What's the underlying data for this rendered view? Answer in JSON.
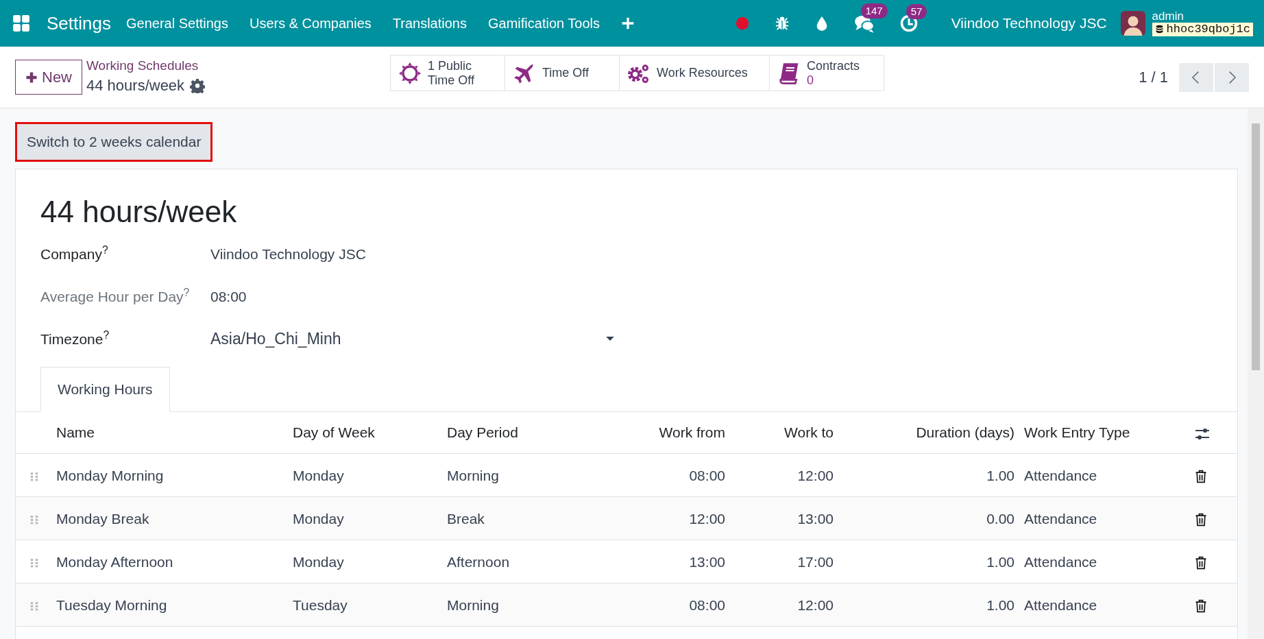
{
  "navbar": {
    "app_name": "Settings",
    "menu": [
      "General Settings",
      "Users & Companies",
      "Translations",
      "Gamification Tools"
    ],
    "systray": [
      {
        "kind": "record"
      },
      {
        "kind": "bug"
      },
      {
        "kind": "drop"
      },
      {
        "kind": "chat",
        "badge": "147"
      },
      {
        "kind": "activity",
        "badge": "57"
      }
    ],
    "company": "Viindoo Technology JSC",
    "user": "admin",
    "database": "hhoc39qboj1c"
  },
  "control_panel": {
    "new_button": "New",
    "breadcrumb": "Working Schedules",
    "record": "44 hours/week",
    "smart_buttons": [
      {
        "kind": "sun",
        "label": "1 Public Time Off"
      },
      {
        "kind": "plane",
        "label": "Time Off"
      },
      {
        "kind": "gears",
        "label": "Work Resources"
      },
      {
        "kind": "book",
        "label": "Contracts",
        "value": "0"
      }
    ],
    "pager": "1 / 1"
  },
  "form": {
    "switch_button": {
      "label": "Switch to 2 weeks calendar",
      "highlighted": true
    },
    "title": "44 hours/week",
    "fields": [
      {
        "label": "Company",
        "help": "?",
        "value": "Viindoo Technology JSC",
        "muted": false,
        "kind": "text"
      },
      {
        "label": "Average Hour per Day",
        "help": "?",
        "value": "08:00",
        "muted": true,
        "kind": "text"
      },
      {
        "label": "Timezone",
        "help": "?",
        "value": "Asia/Ho_Chi_Minh",
        "muted": false,
        "kind": "select"
      }
    ],
    "tabs": [
      {
        "label": "Working Hours",
        "selected": true
      }
    ],
    "table": {
      "columns": [
        "Name",
        "Day of Week",
        "Day Period",
        "Work from",
        "Work to",
        "Duration (days)",
        "Work Entry Type"
      ],
      "rows": [
        [
          "Monday Morning",
          "Monday",
          "Morning",
          "08:00",
          "12:00",
          "1.00",
          "Attendance"
        ],
        [
          "Monday Break",
          "Monday",
          "Break",
          "12:00",
          "13:00",
          "0.00",
          "Attendance"
        ],
        [
          "Monday Afternoon",
          "Monday",
          "Afternoon",
          "13:00",
          "17:00",
          "1.00",
          "Attendance"
        ],
        [
          "Tuesday Morning",
          "Tuesday",
          "Morning",
          "08:00",
          "12:00",
          "1.00",
          "Attendance"
        ]
      ]
    }
  }
}
